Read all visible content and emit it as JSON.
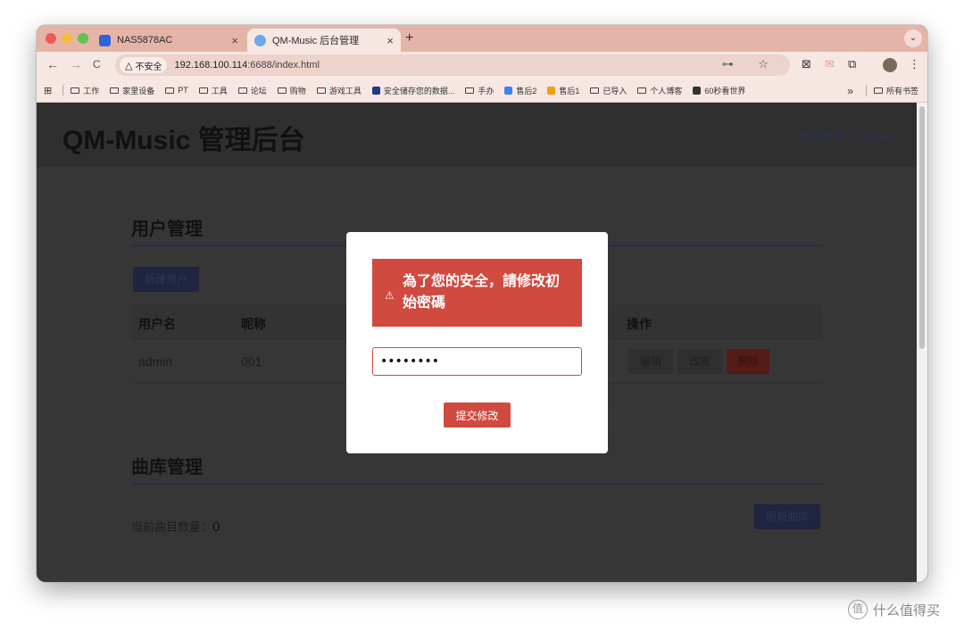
{
  "browser": {
    "tabs": [
      {
        "label": "NAS5878AC",
        "favicon_color": "#2d63d8"
      },
      {
        "label": "QM-Music 后台管理",
        "favicon_color": "#6aa9ea"
      }
    ],
    "new_tab": "+",
    "close_glyph": "×",
    "nav": {
      "back": "←",
      "forward": "→",
      "reload": "C"
    },
    "security_label": "不安全",
    "url_host": "192.168.100.114",
    "url_rest": ":6688/index.html",
    "omnibox_icons": "⊶ ☆",
    "extensions": [
      "⊠",
      "✉",
      "⧉",
      "⋮"
    ],
    "profile_glyph": "⌄",
    "bookmarks": [
      {
        "label": "工作",
        "kind": "folder"
      },
      {
        "label": "家里设备",
        "kind": "folder"
      },
      {
        "label": "PT",
        "kind": "folder"
      },
      {
        "label": "工具",
        "kind": "folder"
      },
      {
        "label": "论坛",
        "kind": "folder"
      },
      {
        "label": "购物",
        "kind": "folder"
      },
      {
        "label": "游戏工具",
        "kind": "folder"
      },
      {
        "label": "安全储存您的数据...",
        "kind": "site",
        "color": "#1e3a8a"
      },
      {
        "label": "手办",
        "kind": "folder"
      },
      {
        "label": "售后2",
        "kind": "site",
        "color": "#3b82f6"
      },
      {
        "label": "售后1",
        "kind": "site",
        "color": "#f59e0b"
      },
      {
        "label": "已导入",
        "kind": "folder"
      },
      {
        "label": "个人博客",
        "kind": "folder"
      },
      {
        "label": "60秒看世界",
        "kind": "site",
        "color": "#333333"
      }
    ],
    "bookmarks_more": "»",
    "all_bookmarks": "所有书签"
  },
  "app": {
    "title": "QM-Music 管理后台",
    "current_user_label": "当前用户：",
    "current_user": "admin"
  },
  "user_card": {
    "title": "用户管理",
    "new_user_button": "新建用户",
    "columns": [
      "用户名",
      "昵称",
      "操作"
    ],
    "rows": [
      {
        "username": "admin",
        "nickname": "001",
        "actions": [
          "编辑",
          "改密",
          "删除"
        ]
      }
    ]
  },
  "library_card": {
    "title": "曲库管理",
    "count_label": "当前曲目数量：",
    "count_value": "0",
    "refresh_button": "刷新曲库"
  },
  "modal": {
    "warning_icon": "⚠",
    "alert_text": "為了您的安全，請修改初始密碼",
    "password_value": "12345678",
    "submit_button": "提交修改"
  },
  "watermark": {
    "icon": "值",
    "text": "什么值得买"
  },
  "colors": {
    "accent_red": "#d14a3f",
    "titlebar": "#e5b4a8",
    "navy": "#262c4f"
  }
}
